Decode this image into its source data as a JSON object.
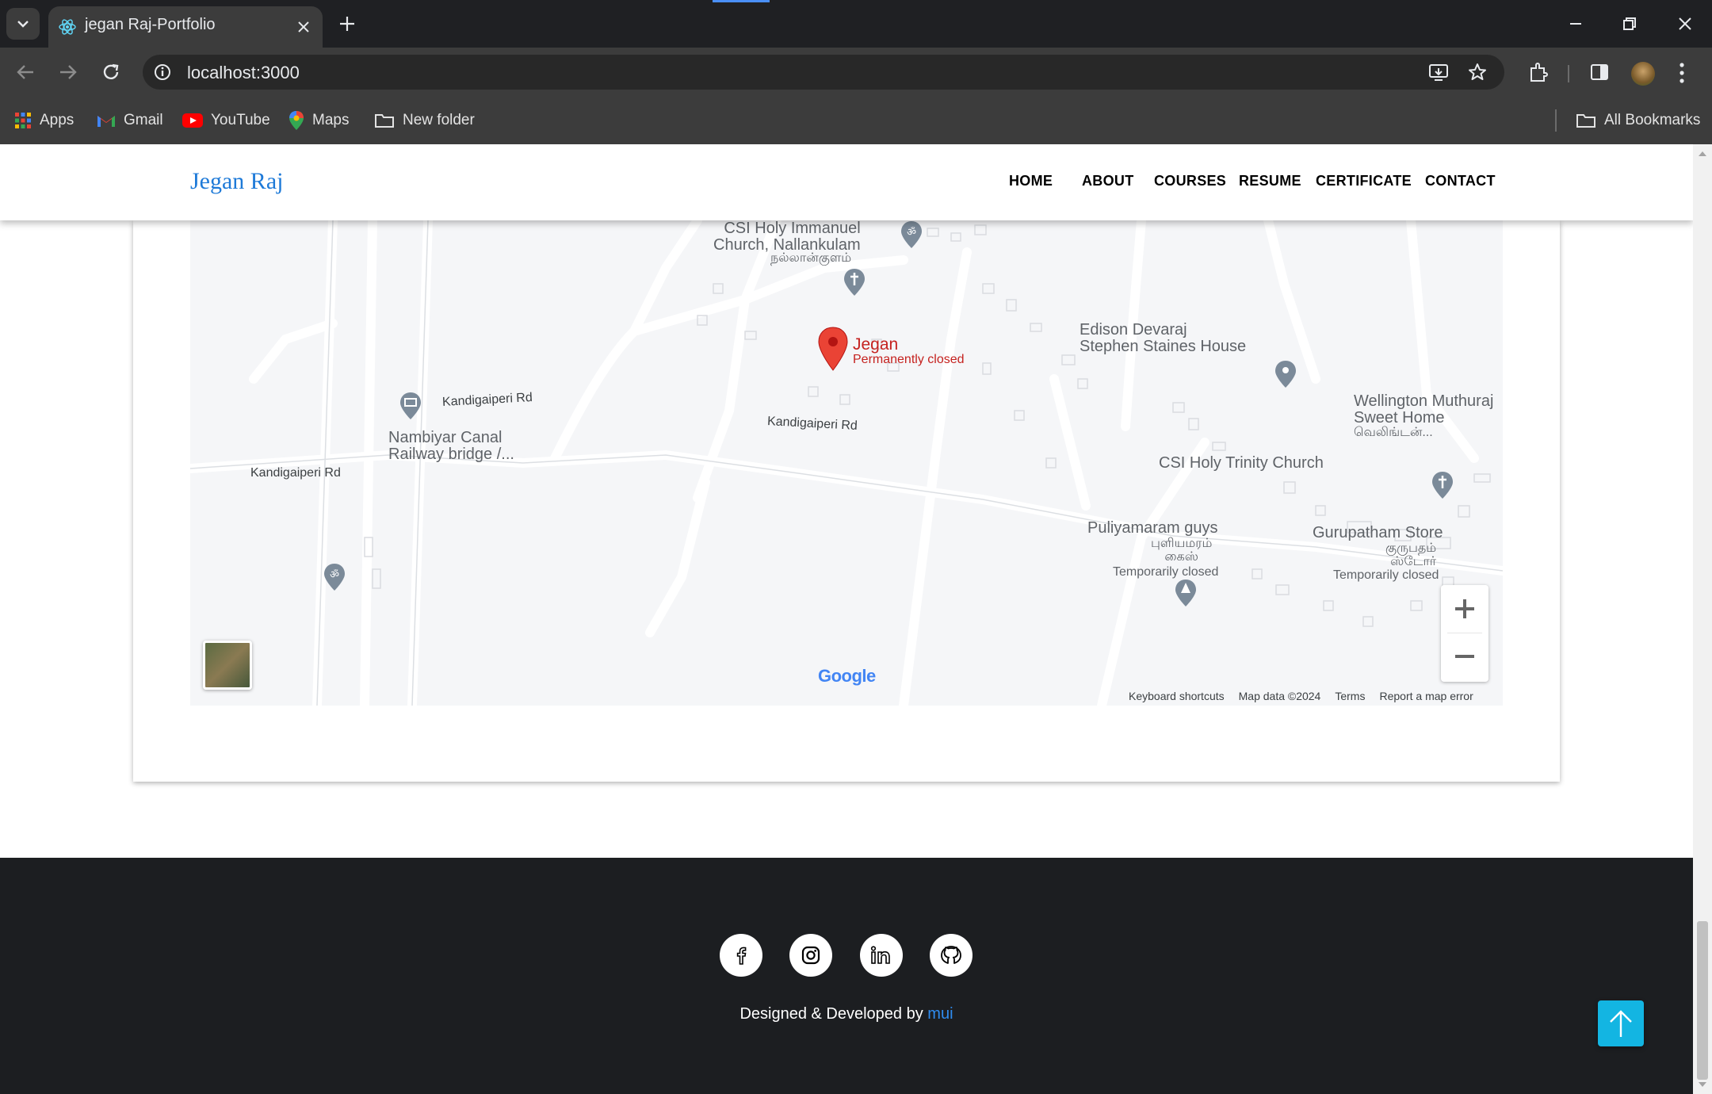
{
  "browser": {
    "tab_title": "jegan Raj-Portfolio",
    "url": "localhost:3000",
    "bookmarks": [
      "Apps",
      "Gmail",
      "YouTube",
      "Maps",
      "New folder"
    ],
    "all_bookmarks": "All Bookmarks"
  },
  "nav": {
    "brand": "Jegan Raj",
    "items": [
      "HOME",
      "ABOUT",
      "COURSES",
      "RESUME",
      "CERTIFICATE",
      "CONTACT"
    ]
  },
  "map": {
    "places": {
      "church1": "CSI Holy Immanuel\nChurch, Nallankulam",
      "church1_tamil": "நல்லான்குளம்",
      "jegan": "Jegan",
      "jegan_status": "Permanently closed",
      "edison": "Edison Devaraj\nStephen Staines House",
      "wellington": "Wellington Muthuraj\nSweet Home",
      "wellington_tamil": "வெலிங்டன்...",
      "csi_trinity": "CSI Holy Trinity Church",
      "nambiyar": "Nambiyar Canal\nRailway bridge /...",
      "puliyamaram": "Puliyamaram guys",
      "puliyamaram_tamil": "புளியமரம்\nகைஸ்",
      "puliyamaram_status": "Temporarily closed",
      "gurupatham": "Gurupatham Store",
      "gurupatham_tamil": "குருபதம்\nஸ்டோர்",
      "gurupatham_status": "Temporarily closed"
    },
    "roads": [
      "Kandigaiperi Rd",
      "Kandigaiperi Rd",
      "Kandigaiperi Rd"
    ],
    "footer": {
      "shortcuts": "Keyboard shortcuts",
      "data": "Map data ©2024",
      "terms": "Terms",
      "report": "Report a map error"
    },
    "google": "Google"
  },
  "footer": {
    "credit_prefix": "Designed & Developed by",
    "credit_link": "mui",
    "social": [
      "facebook-icon",
      "instagram-icon",
      "linkedin-icon",
      "github-icon"
    ]
  },
  "colors": {
    "brand": "#1e7ad8",
    "footer_bg": "#1c1e21",
    "to_top": "#13b5e2",
    "pin_red": "#ea4335"
  }
}
